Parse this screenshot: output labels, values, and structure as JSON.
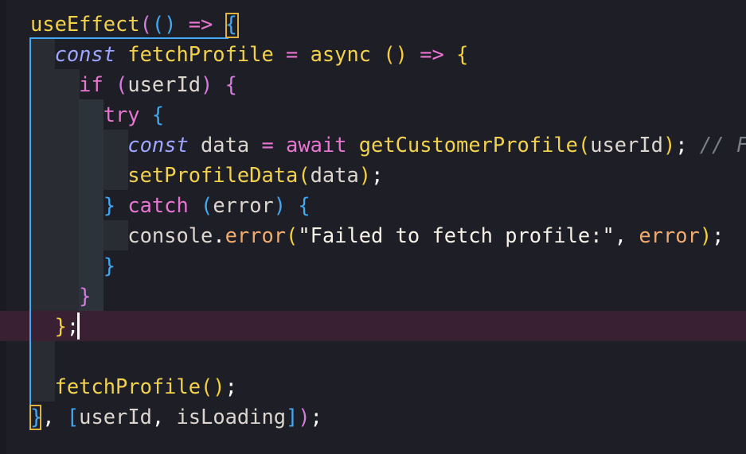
{
  "editor": {
    "lines": [
      {
        "tokens": [
          {
            "text": "useEffect",
            "cls": "t-fn"
          },
          {
            "text": "(",
            "cls": "t-p2"
          },
          {
            "text": "()",
            "cls": "t-p3"
          },
          {
            "text": " => ",
            "cls": "t-op"
          },
          {
            "text": "{",
            "cls": "t-p3"
          }
        ]
      },
      {
        "tokens": [
          {
            "text": "  ",
            "cls": "t-var"
          },
          {
            "text": "const",
            "cls": "t-kw-it"
          },
          {
            "text": " fetchProfile ",
            "cls": "t-fn"
          },
          {
            "text": "=",
            "cls": "t-op"
          },
          {
            "text": " async ",
            "cls": "t-fn"
          },
          {
            "text": "()",
            "cls": "t-p1"
          },
          {
            "text": " => ",
            "cls": "t-op"
          },
          {
            "text": "{",
            "cls": "t-p1"
          }
        ]
      },
      {
        "tokens": [
          {
            "text": "    ",
            "cls": "t-var"
          },
          {
            "text": "if",
            "cls": "t-kw"
          },
          {
            "text": " ",
            "cls": "t-var"
          },
          {
            "text": "(",
            "cls": "t-p2"
          },
          {
            "text": "userId",
            "cls": "t-var"
          },
          {
            "text": ")",
            "cls": "t-p2"
          },
          {
            "text": " ",
            "cls": "t-var"
          },
          {
            "text": "{",
            "cls": "t-p2"
          }
        ]
      },
      {
        "tokens": [
          {
            "text": "      ",
            "cls": "t-var"
          },
          {
            "text": "try",
            "cls": "t-kw"
          },
          {
            "text": " ",
            "cls": "t-var"
          },
          {
            "text": "{",
            "cls": "t-p3"
          }
        ]
      },
      {
        "tokens": [
          {
            "text": "        ",
            "cls": "t-var"
          },
          {
            "text": "const",
            "cls": "t-kw-it"
          },
          {
            "text": " data ",
            "cls": "t-var"
          },
          {
            "text": "=",
            "cls": "t-op"
          },
          {
            "text": " ",
            "cls": "t-var"
          },
          {
            "text": "await",
            "cls": "t-kw"
          },
          {
            "text": " getCustomerProfile",
            "cls": "t-fn"
          },
          {
            "text": "(",
            "cls": "t-p1"
          },
          {
            "text": "userId",
            "cls": "t-var"
          },
          {
            "text": ")",
            "cls": "t-p1"
          },
          {
            "text": ";",
            "cls": "t-punc"
          },
          {
            "text": " // F",
            "cls": "t-cmt"
          }
        ]
      },
      {
        "tokens": [
          {
            "text": "        ",
            "cls": "t-var"
          },
          {
            "text": "setProfileData",
            "cls": "t-fn"
          },
          {
            "text": "(",
            "cls": "t-p1"
          },
          {
            "text": "data",
            "cls": "t-var"
          },
          {
            "text": ")",
            "cls": "t-p1"
          },
          {
            "text": ";",
            "cls": "t-punc"
          }
        ]
      },
      {
        "tokens": [
          {
            "text": "      ",
            "cls": "t-var"
          },
          {
            "text": "}",
            "cls": "t-p3"
          },
          {
            "text": " ",
            "cls": "t-var"
          },
          {
            "text": "catch",
            "cls": "t-kw"
          },
          {
            "text": " ",
            "cls": "t-var"
          },
          {
            "text": "(",
            "cls": "t-p3"
          },
          {
            "text": "error",
            "cls": "t-var"
          },
          {
            "text": ")",
            "cls": "t-p3"
          },
          {
            "text": " ",
            "cls": "t-var"
          },
          {
            "text": "{",
            "cls": "t-p3"
          }
        ]
      },
      {
        "tokens": [
          {
            "text": "        ",
            "cls": "t-var"
          },
          {
            "text": "console",
            "cls": "t-var"
          },
          {
            "text": ".",
            "cls": "t-punc"
          },
          {
            "text": "error",
            "cls": "t-param"
          },
          {
            "text": "(",
            "cls": "t-p1"
          },
          {
            "text": "\"Failed to fetch profile:\"",
            "cls": "t-str"
          },
          {
            "text": ", ",
            "cls": "t-punc"
          },
          {
            "text": "error",
            "cls": "t-param"
          },
          {
            "text": ")",
            "cls": "t-p1"
          },
          {
            "text": ";",
            "cls": "t-punc"
          }
        ]
      },
      {
        "tokens": [
          {
            "text": "      ",
            "cls": "t-var"
          },
          {
            "text": "}",
            "cls": "t-p3"
          }
        ]
      },
      {
        "tokens": [
          {
            "text": "    ",
            "cls": "t-var"
          },
          {
            "text": "}",
            "cls": "t-p2"
          }
        ]
      },
      {
        "tokens": [
          {
            "text": "  ",
            "cls": "t-var"
          },
          {
            "text": "}",
            "cls": "t-p1"
          },
          {
            "text": ";",
            "cls": "t-punc"
          }
        ]
      },
      {
        "tokens": []
      },
      {
        "tokens": [
          {
            "text": "  ",
            "cls": "t-var"
          },
          {
            "text": "fetchProfile",
            "cls": "t-fn"
          },
          {
            "text": "()",
            "cls": "t-p1"
          },
          {
            "text": ";",
            "cls": "t-punc"
          }
        ]
      },
      {
        "tokens": [
          {
            "text": "}",
            "cls": "t-p3"
          },
          {
            "text": ", ",
            "cls": "t-punc"
          },
          {
            "text": "[",
            "cls": "t-p3"
          },
          {
            "text": "userId",
            "cls": "t-var"
          },
          {
            "text": ", ",
            "cls": "t-punc"
          },
          {
            "text": "isLoading",
            "cls": "t-var"
          },
          {
            "text": "]",
            "cls": "t-p3"
          },
          {
            "text": ")",
            "cls": "t-p2"
          },
          {
            "text": ";",
            "cls": "t-punc"
          }
        ]
      }
    ]
  },
  "colors": {
    "background": "#1e1f26",
    "current_line": "#3a2033",
    "scope_guide": "#3fa9f5",
    "bracket_match": "#e0b33f"
  }
}
